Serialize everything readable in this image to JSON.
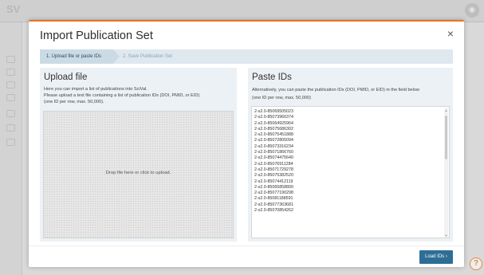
{
  "background": {
    "help_label": "?"
  },
  "modal": {
    "title": "Import Publication Set",
    "close_label": "×",
    "steps": [
      {
        "label": "1. Upload file or paste IDs"
      },
      {
        "label": "2. Save Publication Set"
      }
    ],
    "upload": {
      "heading": "Upload file",
      "line1": "Here you can import a list of publications into SciVal.",
      "line2": "Please upload a text file containing a list of publication IDs (DOI, PMID, or EID)",
      "line3": "(one ID per row, max. 50,000).",
      "dropzone_label": "Drop file here or click to upload."
    },
    "paste": {
      "heading": "Paste IDs",
      "line1": "Alternatively, you can paste the publication IDs (DOI, PMID, or EID) in the field below",
      "line2": "(one ID per row, max. 50,000)",
      "ids": [
        "2-s2.0-85069505023",
        "2-s2.0-85073966374",
        "2-s2.0-85064925964",
        "2-s2.0-85075686302",
        "2-s2.0-85075451888",
        "2-s2.0-85072805094",
        "2-s2.0-85073316234",
        "2-s2.0-85071866760",
        "2-s2.0-85074475640",
        "2-s2.0-85076911284",
        "2-s2.0-85071729278",
        "2-s2.0-85075382520",
        "2-s2.0-85074412119",
        "2-s2.0-85065858800",
        "2-s2.0-85077190298",
        "2-s2.0-85081188591",
        "2-s2.0-85077363681",
        "2-s2.0-85070854262"
      ]
    },
    "load_button": "Load IDs  ›"
  }
}
